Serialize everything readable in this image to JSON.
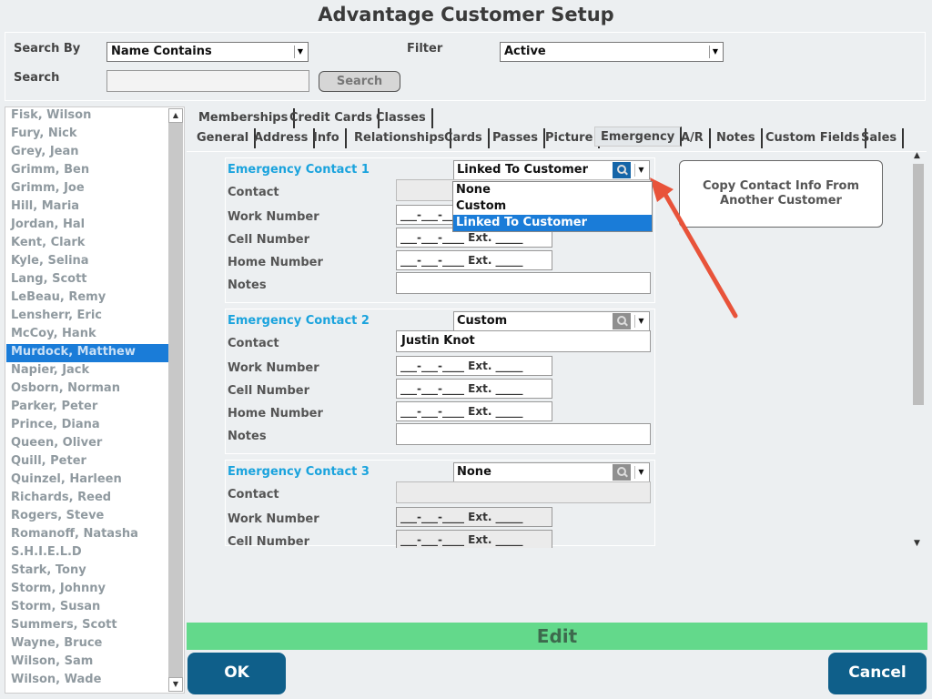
{
  "title": "Advantage Customer Setup",
  "search": {
    "search_by_label": "Search By",
    "search_by_value": "Name Contains",
    "filter_label": "Filter",
    "filter_value": "Active",
    "search_label": "Search",
    "search_value": "",
    "search_button": "Search"
  },
  "customers": [
    "Fisk, Wilson",
    "Fury, Nick",
    "Grey, Jean",
    "Grimm, Ben",
    "Grimm, Joe",
    "Hill, Maria",
    "Jordan, Hal",
    "Kent, Clark",
    "Kyle, Selina",
    "Lang, Scott",
    "LeBeau, Remy",
    "Lensherr, Eric",
    "McCoy, Hank",
    "Murdock, Matthew",
    "Napier, Jack",
    "Osborn, Norman",
    "Parker, Peter",
    "Prince, Diana",
    "Queen, Oliver",
    "Quill, Peter",
    "Quinzel, Harleen",
    "Richards, Reed",
    "Rogers, Steve",
    "Romanoff, Natasha",
    "S.H.I.E.L.D",
    "Stark, Tony",
    "Storm, Johnny",
    "Storm, Susan",
    "Summers, Scott",
    "Wayne, Bruce",
    "Wilson, Sam",
    "Wilson, Wade"
  ],
  "selected_customer": "Murdock, Matthew",
  "tabs_row1": [
    "Memberships",
    "Credit Cards",
    "Classes"
  ],
  "tabs_row2": [
    "General",
    "Address",
    "Info",
    "Relationships",
    "Cards",
    "Passes",
    "Picture",
    "Emergency",
    "A/R",
    "Notes",
    "Custom Fields",
    "Sales"
  ],
  "active_tab": "Emergency",
  "labels": {
    "contact": "Contact",
    "work": "Work Number",
    "cell": "Cell Number",
    "home": "Home Number",
    "notes": "Notes",
    "phone_placeholder": "___-___-____ Ext. _____"
  },
  "emergency": [
    {
      "title": "Emergency Contact 1",
      "type": "Linked To Customer",
      "contact": "",
      "notes": ""
    },
    {
      "title": "Emergency Contact 2",
      "type": "Custom",
      "contact": "Justin Knot",
      "notes": ""
    },
    {
      "title": "Emergency Contact 3",
      "type": "None",
      "contact": "",
      "notes": ""
    }
  ],
  "dropdown_options": [
    "None",
    "Custom",
    "Linked To Customer"
  ],
  "dropdown_selected": "Linked To Customer",
  "copy_button": "Copy Contact Info From Another Customer",
  "edit_label": "Edit",
  "ok_label": "OK",
  "cancel_label": "Cancel",
  "colors": {
    "accent": "#1a7cd8",
    "section_title": "#1aa3dd",
    "edit_bar": "#63d98b",
    "primary_button": "#0f5f8a",
    "annotation_arrow": "#e8533a"
  }
}
